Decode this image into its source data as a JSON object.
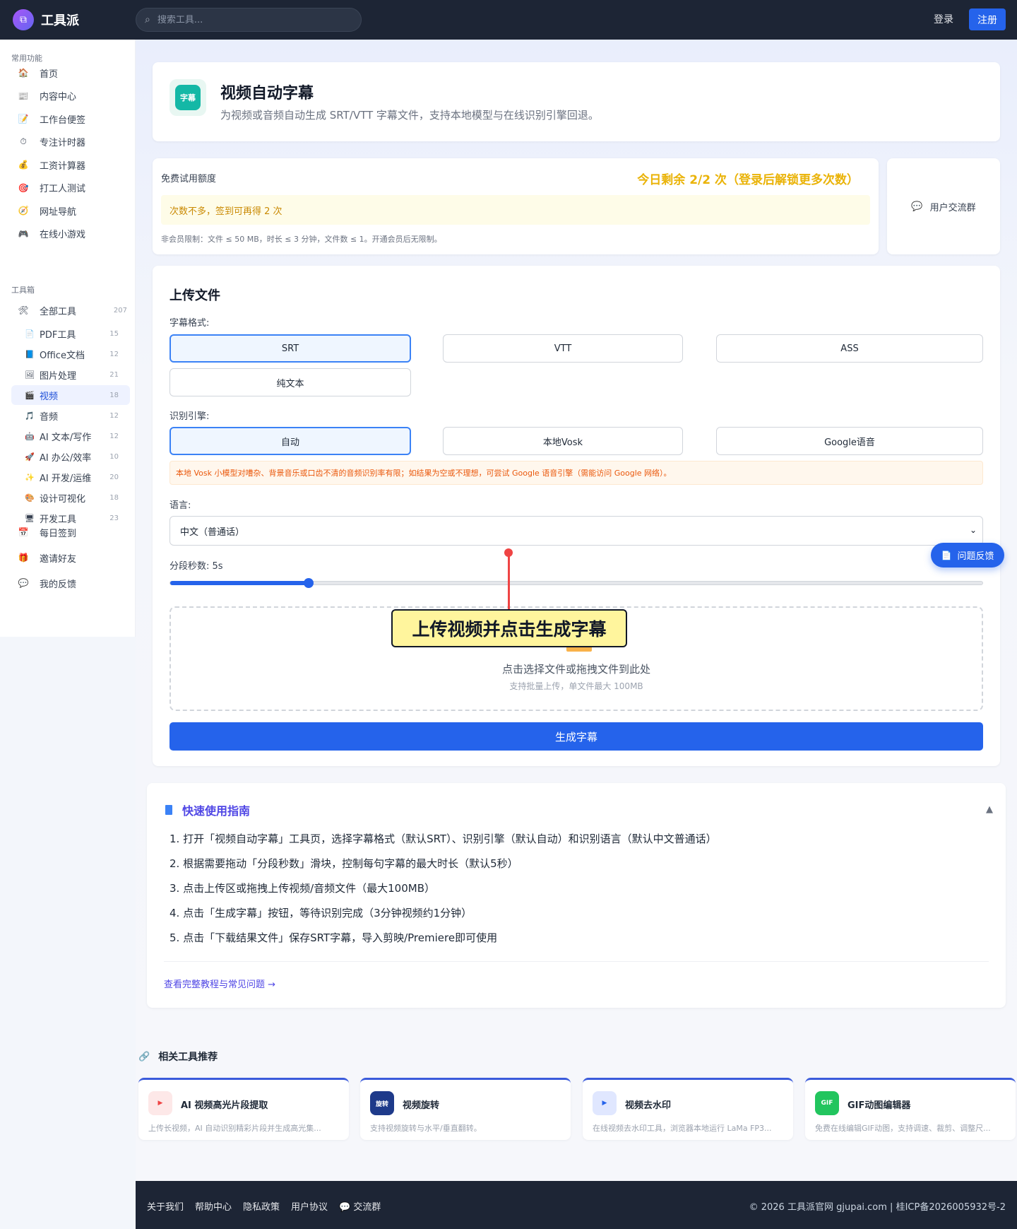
{
  "header": {
    "logo_text": "工具派",
    "search_placeholder": "搜索工具...",
    "login": "登录",
    "register": "注册"
  },
  "sidebar": {
    "common_section": "常用功能",
    "common_items": [
      {
        "label": "首页",
        "icon": "home-icon",
        "glyph": "🏠"
      },
      {
        "label": "内容中心",
        "icon": "news-icon",
        "glyph": "📰"
      },
      {
        "label": "工作台便签",
        "icon": "note-icon",
        "glyph": "📝"
      },
      {
        "label": "专注计时器",
        "icon": "timer-icon",
        "glyph": "⏱"
      },
      {
        "label": "工资计算器",
        "icon": "money-bag-icon",
        "glyph": "💰"
      },
      {
        "label": "打工人测试",
        "icon": "target-icon",
        "glyph": "🎯"
      },
      {
        "label": "网址导航",
        "icon": "compass-icon",
        "glyph": "🧭"
      },
      {
        "label": "在线小游戏",
        "icon": "gamepad-icon",
        "glyph": "🎮"
      }
    ],
    "toolbox_section": "工具箱",
    "all_tools": {
      "label": "全部工具",
      "count": "207",
      "glyph": "🛠"
    },
    "tool_items": [
      {
        "label": "PDF工具",
        "count": "15",
        "icon": "pdf-icon",
        "glyph": "📄"
      },
      {
        "label": "Office文档",
        "count": "12",
        "icon": "book-icon",
        "glyph": "📘"
      },
      {
        "label": "图片处理",
        "count": "21",
        "icon": "image-icon",
        "glyph": "🖼"
      },
      {
        "label": "视频",
        "count": "18",
        "icon": "clapper-icon",
        "glyph": "🎬"
      },
      {
        "label": "音频",
        "count": "12",
        "icon": "music-icon",
        "glyph": "🎵"
      },
      {
        "label": "AI 文本/写作",
        "count": "12",
        "icon": "robot-icon",
        "glyph": "🤖"
      },
      {
        "label": "AI 办公/效率",
        "count": "10",
        "icon": "rocket-icon",
        "glyph": "🚀"
      },
      {
        "label": "AI 开发/运维",
        "count": "20",
        "icon": "sparkle-icon",
        "glyph": "✨"
      },
      {
        "label": "设计可视化",
        "count": "18",
        "icon": "palette-icon",
        "glyph": "🎨"
      },
      {
        "label": "开发工具",
        "count": "23",
        "icon": "monitor-icon",
        "glyph": "🖥"
      }
    ],
    "bottom_items": [
      {
        "label": "每日签到",
        "icon": "calendar-icon",
        "glyph": "📅"
      },
      {
        "label": "邀请好友",
        "icon": "gift-icon",
        "glyph": "🎁"
      },
      {
        "label": "我的反馈",
        "icon": "speech-bubble-icon",
        "glyph": "💬"
      }
    ]
  },
  "tool_header": {
    "icon_text": "字幕",
    "title": "视频自动字幕",
    "subtitle": "为视频或音频自动生成 SRT/VTT 字幕文件，支持本地模型与在线识别引擎回退。"
  },
  "quota": {
    "label": "免费试用额度",
    "remaining": "今日剩余 2/2 次（登录后解锁更多次数）",
    "note": "次数不多，签到可再得 2 次",
    "limit": "非会员限制：文件 ≤ 50 MB，时长 ≤ 3 分钟，文件数 ≤ 1。开通会员后无限制。"
  },
  "group": {
    "label": "用户交流群"
  },
  "upload": {
    "title": "上传文件",
    "format_label": "字幕格式:",
    "formats": [
      "SRT",
      "VTT",
      "ASS",
      "纯文本"
    ],
    "engine_label": "识别引擎:",
    "engines": [
      "自动",
      "本地Vosk",
      "Google语音"
    ],
    "warning": "本地 Vosk 小模型对嘈杂、背景音乐或口齿不清的音频识别率有限；如结果为空或不理想，可尝试 Google 语音引擎（需能访问 Google 网络）。",
    "language_label": "语言:",
    "language_value": "中文（普通话）",
    "segment_label": "分段秒数: 5s",
    "segment_fraction": 0.17,
    "drop_main": "点击选择文件或拖拽文件到此处",
    "drop_sub": "支持批量上传，单文件最大 100MB",
    "generate": "生成字幕"
  },
  "annotation": {
    "callout": "上传视频并点击生成字幕"
  },
  "feedback": {
    "label": "问题反馈"
  },
  "guide": {
    "title": "快速使用指南",
    "toggle": "▲",
    "steps": [
      "1. 打开「视频自动字幕」工具页，选择字幕格式（默认SRT）、识别引擎（默认自动）和识别语言（默认中文普通话）",
      "2. 根据需要拖动「分段秒数」滑块，控制每句字幕的最大时长（默认5秒）",
      "3. 点击上传区或拖拽上传视频/音频文件（最大100MB）",
      "4. 点击「生成字幕」按钮，等待识别完成（3分钟视频约1分钟）",
      "5. 点击「下载结果文件」保存SRT字幕，导入剪映/Premiere即可使用"
    ],
    "link": "查看完整教程与常见问题 →"
  },
  "related": {
    "title": "相关工具推荐",
    "items": [
      {
        "name": "AI 视频高光片段提取",
        "desc": "上传长视频，AI 自动识别精彩片段并生成高光集...",
        "icon_text": "▶",
        "icon_bg": "#fde8e8",
        "icon_color": "#ef4444"
      },
      {
        "name": "视频旋转",
        "desc": "支持视频旋转与水平/垂直翻转。",
        "icon_text": "旋转",
        "icon_bg": "#1e3a8a",
        "icon_color": "#ffffff"
      },
      {
        "name": "视频去水印",
        "desc": "在线视频去水印工具，浏览器本地运行 LaMa FP3...",
        "icon_text": "▶",
        "icon_bg": "#e0e7ff",
        "icon_color": "#2563eb"
      },
      {
        "name": "GIF动图编辑器",
        "desc": "免费在线编辑GIF动图，支持调速、裁剪、调整尺...",
        "icon_text": "GIF",
        "icon_bg": "#22c55e",
        "icon_color": "#ffffff"
      }
    ]
  },
  "footer": {
    "links": [
      "关于我们",
      "帮助中心",
      "隐私政策",
      "用户协议",
      "💬 交流群"
    ],
    "copyright": "© 2026 工具派官网 gjupai.com | 桂ICP备2026005932号-2"
  }
}
